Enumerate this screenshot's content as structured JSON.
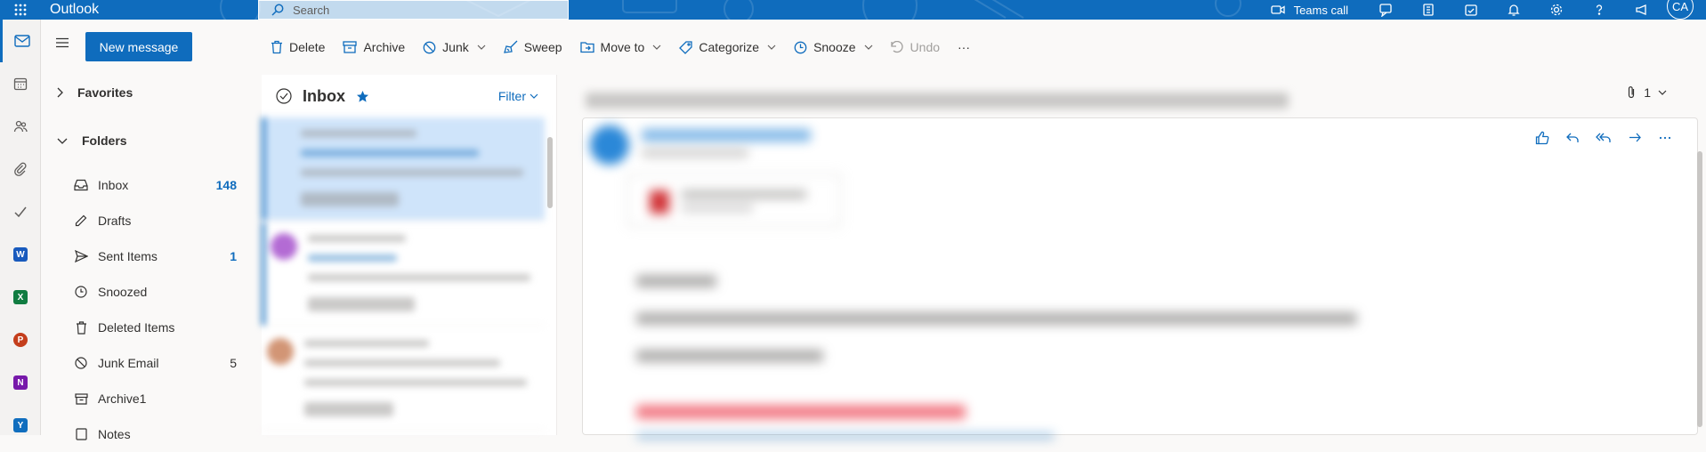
{
  "app": {
    "name": "Outlook"
  },
  "search": {
    "placeholder": "Search"
  },
  "header": {
    "teams_call": "Teams call",
    "avatar_initials": "CA"
  },
  "new_message_label": "New message",
  "toolbar": {
    "delete": "Delete",
    "archive": "Archive",
    "junk": "Junk",
    "sweep": "Sweep",
    "move_to": "Move to",
    "categorize": "Categorize",
    "snooze": "Snooze",
    "undo": "Undo",
    "more": "···"
  },
  "nav": {
    "favorites": "Favorites",
    "folders": "Folders",
    "items": [
      {
        "label": "Inbox",
        "count": "148",
        "icon": "inbox-icon"
      },
      {
        "label": "Drafts",
        "count": "",
        "icon": "pencil-icon"
      },
      {
        "label": "Sent Items",
        "count": "1",
        "icon": "send-icon"
      },
      {
        "label": "Snoozed",
        "count": "",
        "icon": "clock-icon"
      },
      {
        "label": "Deleted Items",
        "count": "",
        "icon": "trash-icon"
      },
      {
        "label": "Junk Email",
        "count": "5",
        "icon": "block-icon"
      },
      {
        "label": "Archive1",
        "count": "",
        "icon": "archive-icon"
      },
      {
        "label": "Notes",
        "count": "",
        "icon": "note-icon"
      }
    ]
  },
  "list": {
    "title": "Inbox",
    "filter": "Filter"
  },
  "reading": {
    "attachment_count": "1"
  },
  "colors": {
    "accent": "#0f6cbd",
    "selected_row": "#cfe4fa"
  }
}
